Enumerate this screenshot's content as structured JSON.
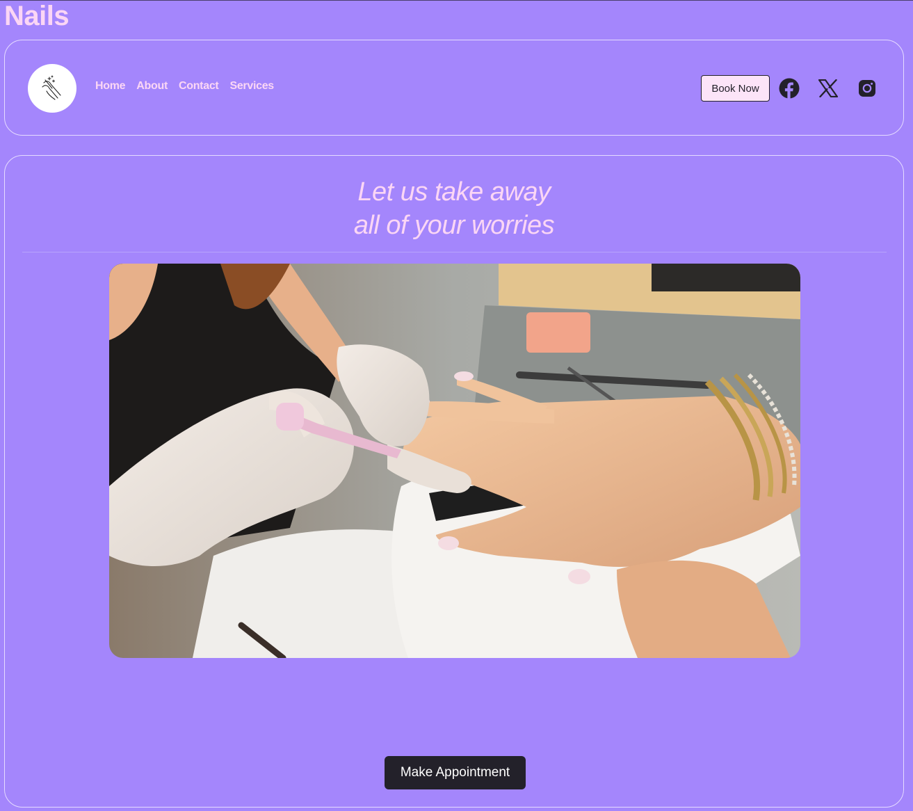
{
  "site": {
    "title": "Nails"
  },
  "nav": {
    "links": [
      {
        "label": "Home"
      },
      {
        "label": "About"
      },
      {
        "label": "Contact"
      },
      {
        "label": "Services"
      }
    ],
    "book_label": "Book Now",
    "social": [
      {
        "icon": "facebook-icon"
      },
      {
        "icon": "x-icon"
      },
      {
        "icon": "instagram-icon"
      }
    ]
  },
  "hero": {
    "tagline_line1": "Let us take away",
    "tagline_line2": "all of your worries",
    "image_icon": "manicure-photo",
    "cta_label": "Make Appointment"
  },
  "colors": {
    "background": "#a486fc",
    "accent_text": "#fbd6f5",
    "button_dark": "#23212a",
    "button_light": "#fce4f8"
  }
}
